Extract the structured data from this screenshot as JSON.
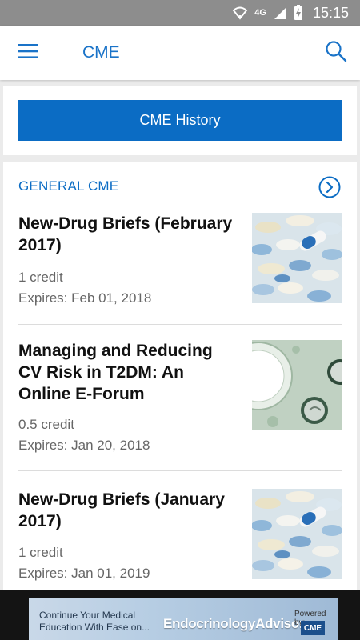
{
  "status_bar": {
    "network": "4G",
    "time": "15:15"
  },
  "app_bar": {
    "title": "CME",
    "menu_icon": "hamburger-menu-icon",
    "search_icon": "search-icon"
  },
  "history_button": {
    "label": "CME History"
  },
  "section": {
    "title": "GENERAL CME",
    "arrow_icon": "chevron-right-circle-icon"
  },
  "items": [
    {
      "title": "New-Drug Briefs (February 2017)",
      "credit": "1 credit",
      "expires": "Expires: Feb 01, 2018",
      "thumbnail": "pills-image"
    },
    {
      "title": "Managing and Reducing CV Risk in T2DM: An Online E-Forum",
      "credit": "0.5 credit",
      "expires": "Expires: Jan 20, 2018",
      "thumbnail": "forum-graphic-image"
    },
    {
      "title": "New-Drug Briefs (January 2017)",
      "credit": "1 credit",
      "expires": "Expires: Jan 01, 2019",
      "thumbnail": "pills-image"
    }
  ],
  "ad": {
    "tagline": "Continue Your Medical Education With Ease on...",
    "brand": "EndocrinologyAdvisor",
    "powered_by": "Powered by:",
    "logo_text": "CME"
  },
  "colors": {
    "accent": "#0b6cc4",
    "status_bar": "#8d8d8d",
    "background": "#ebebeb"
  }
}
